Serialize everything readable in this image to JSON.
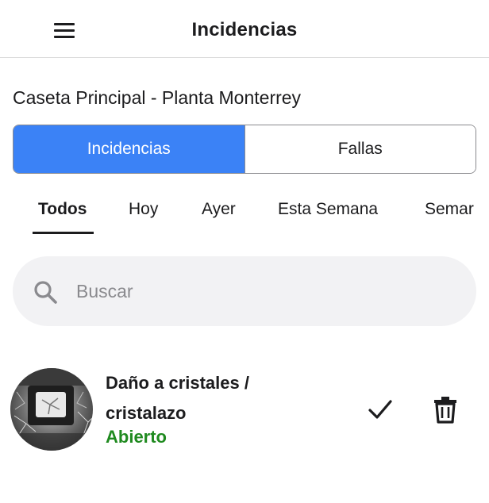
{
  "header": {
    "title": "Incidencias",
    "menu_icon": "hamburger-menu-icon"
  },
  "location": "Caseta Principal - Planta Monterrey",
  "segments": [
    {
      "label": "Incidencias",
      "active": true
    },
    {
      "label": "Fallas",
      "active": false
    }
  ],
  "filters": [
    {
      "label": "Todos",
      "active": true
    },
    {
      "label": "Hoy",
      "active": false
    },
    {
      "label": "Ayer",
      "active": false
    },
    {
      "label": "Esta Semana",
      "active": false
    },
    {
      "label": "Semar",
      "active": false
    }
  ],
  "search": {
    "placeholder": "Buscar",
    "value": "",
    "icon": "search-icon"
  },
  "incidents": [
    {
      "title": "Daño a cristales / cristalazo",
      "status": "Abierto",
      "status_color": "#1f8a1f",
      "thumbnail_icon": "broken-glass-photo",
      "actions": [
        "check-icon",
        "trash-icon"
      ]
    }
  ],
  "colors": {
    "accent": "#3b82f6",
    "status_open": "#1f8a1f",
    "search_bg": "#f2f2f4"
  }
}
